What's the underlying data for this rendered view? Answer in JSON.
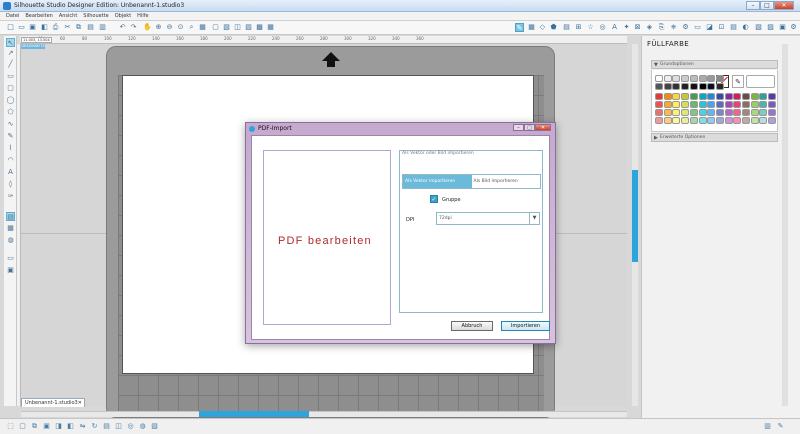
{
  "window": {
    "title": "Silhouette Studio Designer Edition: Unbenannt-1.studio3",
    "min": "–",
    "max": "□",
    "close": "✕"
  },
  "menu": [
    "Datei",
    "Bearbeiten",
    "Ansicht",
    "Silhouette",
    "Objekt",
    "Hilfe"
  ],
  "ruler": {
    "coords": "11.003, 13.504",
    "ticks": [
      "40",
      "60",
      "80",
      "100",
      "120",
      "140",
      "160",
      "180",
      "200",
      "220",
      "240",
      "260",
      "280",
      "300",
      "320",
      "340",
      "360"
    ]
  },
  "workspace": {
    "badge": "DESIGNSEITE"
  },
  "document": {
    "tab_label": "Unbenannt-1.studio3",
    "tab_close": "✕"
  },
  "panel": {
    "title": "FÜLLFARBE",
    "section_basic": "Grundoptionen",
    "section_advanced": "Erweiterte Optionen",
    "swatch_colors": [
      "#ffffff",
      "#eeeeee",
      "#dddddd",
      "#cccccc",
      "#bbbbbb",
      "#aaaaaa",
      "#999999",
      "#888888",
      "#555555",
      "#444444",
      "#333333",
      "#222222",
      "#111111",
      "#000000",
      "#0b0b2b",
      "#2a2a2a",
      "#e53935",
      "#fb8c00",
      "#fdd835",
      "#c0ca33",
      "#43a047",
      "#00acc1",
      "#1e88e5",
      "#3949ab",
      "#8e24aa",
      "#d81b60",
      "#6d4c41",
      "#7cb342",
      "#26a69a",
      "#5e35b1",
      "#ef5350",
      "#ffa726",
      "#ffee58",
      "#d4e157",
      "#66bb6a",
      "#26c6da",
      "#42a5f5",
      "#5c6bc0",
      "#ab47bc",
      "#ec407a",
      "#8d6e63",
      "#9ccc65",
      "#4db6ac",
      "#7e57c2",
      "#e57373",
      "#ffb74d",
      "#fff176",
      "#dce775",
      "#81c784",
      "#4dd0e1",
      "#64b5f6",
      "#7986cb",
      "#ba68c8",
      "#f06292",
      "#a1887f",
      "#aed581",
      "#80cbc4",
      "#9575cd",
      "#ef9a9a",
      "#ffcc80",
      "#fff59d",
      "#e6ee9c",
      "#a5d6a7",
      "#80deea",
      "#90caf9",
      "#9fa8da",
      "#ce93d8",
      "#f48fb1",
      "#bcaaa4",
      "#c5e1a5",
      "#b2dfdb",
      "#b39ddb"
    ]
  },
  "dialog": {
    "title": "PDF-Import",
    "min": "–",
    "max": "□",
    "close": "✕",
    "preview_text": "PDF bearbeiten",
    "options_header": "Als Vektor oder Bild importieren",
    "opt_vector": "Als Vektor importieren",
    "opt_image": "Als Bild importieren",
    "checkbox_label": "Gruppe",
    "checkbox_mark": "✓",
    "dpi_label": "DPI",
    "dpi_value": "72dpi",
    "dpi_arrow": "▼",
    "cancel_label": "Abbruch",
    "import_label": "Importieren"
  },
  "icons": {
    "toolbar": [
      "new-icon",
      "open-icon",
      "save-icon",
      "print-icon",
      "cut-send-icon",
      "cut-icon",
      "copy-icon",
      "paste-icon",
      "undo-icon",
      "redo-icon",
      "hand-icon",
      "zoom-in-icon",
      "zoom-out-icon",
      "zoom-fit-icon",
      "fit-page-icon",
      "fill-icon",
      "group-icon",
      "ungroup-icon",
      "weld-icon",
      "design-icon",
      "grid-icon",
      "shape-icon",
      "align-icon",
      "replicate-icon",
      "text-icon",
      "trace-icon",
      "store-icon",
      "send-icon",
      "star-icon",
      "offset-icon",
      "library-icon",
      "settings-icon",
      "cut-settings-icon",
      "gear-icon"
    ],
    "left": [
      "select-icon",
      "edit-points-icon",
      "line-icon",
      "rectangle-icon",
      "rounded-rect-icon",
      "ellipse-icon",
      "polygon-icon",
      "curve-icon",
      "freehand-icon",
      "smooth-icon",
      "arc-icon",
      "knife-icon",
      "text-icon",
      "eraser-icon",
      "pen-icon",
      "draw-mode-icon",
      "library-icon",
      "shop-icon",
      "page-setup-icon",
      "media-icon"
    ]
  }
}
